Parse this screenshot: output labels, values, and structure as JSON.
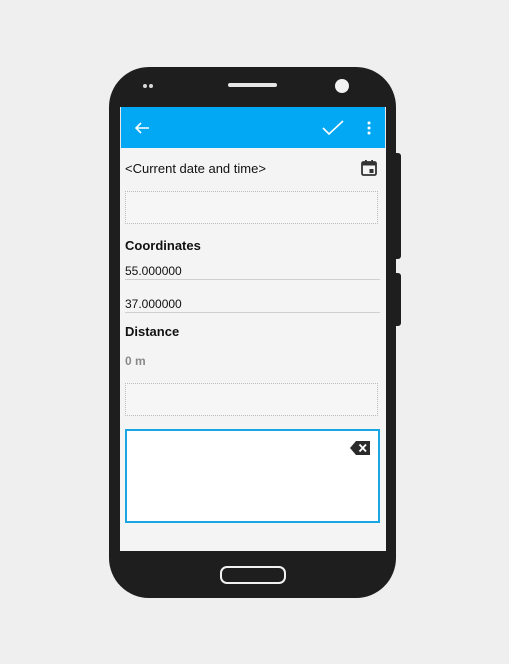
{
  "toolbar": {
    "back_icon": "arrow-left-icon",
    "confirm_icon": "check-icon",
    "menu_icon": "more-vert-icon",
    "accent_color": "#02a8f3"
  },
  "form": {
    "date_text": "<Current date and time>",
    "date_icon": "calendar-icon",
    "coordinates_label": "Coordinates",
    "latitude": "55.000000",
    "longitude": "37.000000",
    "distance_label": "Distance",
    "distance_value": "0 m",
    "note_text": "",
    "clear_icon": "backspace-icon"
  }
}
